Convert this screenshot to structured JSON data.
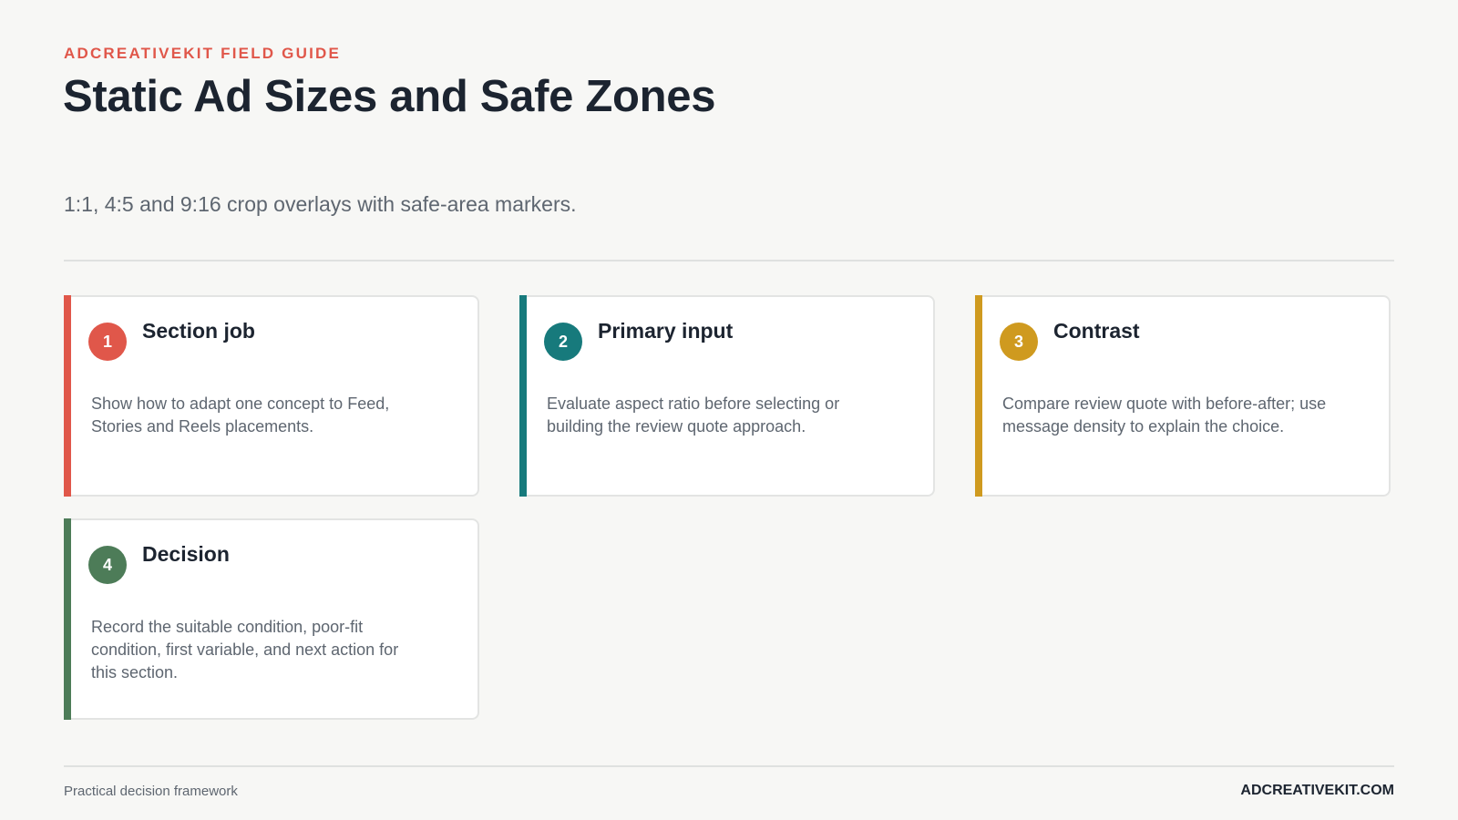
{
  "header": {
    "eyebrow": "ADCREATIVEKIT FIELD GUIDE",
    "title": "Static Ad Sizes and Safe Zones",
    "subtitle": "1:1, 4:5 and 9:16 crop overlays with safe-area markers."
  },
  "cards": [
    {
      "number": "1",
      "title": "Section job",
      "body": "Show how to adapt one concept to Feed, Stories and Reels placements.",
      "color": "#e0574a"
    },
    {
      "number": "2",
      "title": "Primary input",
      "body": "Evaluate aspect ratio before selecting or building the review quote approach.",
      "color": "#177a7c"
    },
    {
      "number": "3",
      "title": "Contrast",
      "body": "Compare review quote with before-after; use message density to explain the choice.",
      "color": "#cf9a1f"
    },
    {
      "number": "4",
      "title": "Decision",
      "body": "Record the suitable condition, poor-fit condition, first variable, and next action for this section.",
      "color": "#4d7c58"
    }
  ],
  "footer": {
    "left": "Practical decision framework",
    "right": "ADCREATIVEKIT.COM"
  }
}
